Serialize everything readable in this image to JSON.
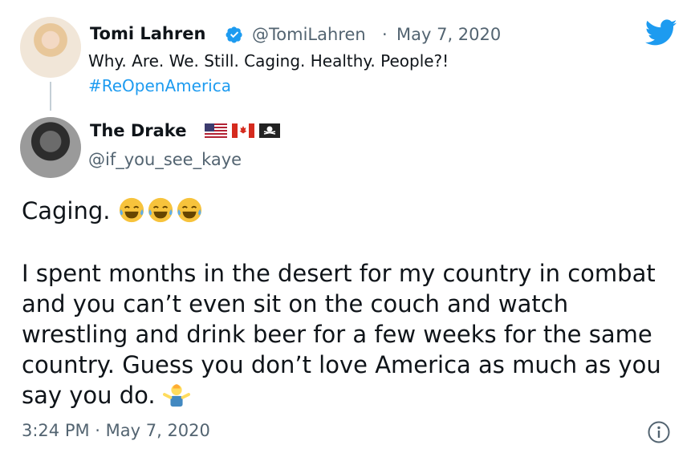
{
  "quoted_tweet": {
    "author_name": "Tomi Lahren",
    "handle": "@TomiLahren",
    "separator": "·",
    "date": "May 7, 2020",
    "text": "Why. Are. We. Still. Caging. Healthy. People?!",
    "hashtag": "#ReOpenAmerica"
  },
  "reply_tweet": {
    "author_name": "The Drake",
    "handle": "@if_you_see_kaye",
    "line1": "Caging.",
    "body": "I spent months in the desert for my country in combat and you can’t even sit on the couch and watch wrestling and drink beer for a few weeks for the same country. Guess you don’t love America as much as you say you do.",
    "timestamp": "3:24 PM · May 7, 2020"
  },
  "icons": {
    "verified": "verified-badge-icon",
    "brand": "twitter-bird-icon",
    "info": "info-icon",
    "emoji_laugh": "face-with-tears-of-joy-emoji",
    "emoji_shrug": "person-shrugging-emoji"
  },
  "colors": {
    "brand_blue": "#1d9bf0",
    "text": "#0f1419",
    "muted": "#536471"
  }
}
